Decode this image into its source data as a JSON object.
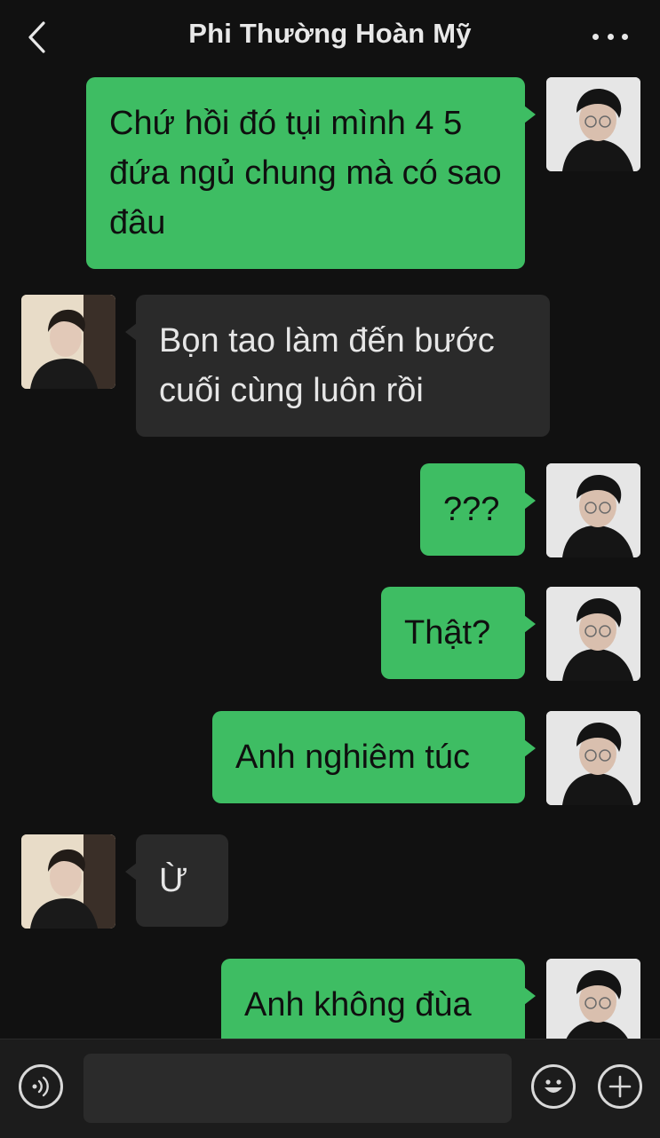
{
  "header": {
    "title": "Phi Thường Hoàn Mỹ",
    "back_icon": "chevron-left-icon",
    "more_icon": "more-dots-icon"
  },
  "messages": [
    {
      "sender": "self",
      "text": "Chứ hồi đó tụi mình 4 5 đứa ngủ chung mà có sao đâu"
    },
    {
      "sender": "other",
      "text": "Bọn tao làm đến bước cuối cùng luôn rồi"
    },
    {
      "sender": "self",
      "text": "???"
    },
    {
      "sender": "self",
      "text": "Thật?"
    },
    {
      "sender": "self",
      "text": "Anh nghiêm túc"
    },
    {
      "sender": "other",
      "text": "Ừ"
    },
    {
      "sender": "self",
      "text": "Anh không đùa"
    }
  ],
  "input": {
    "value": "",
    "voice_icon": "voice-icon",
    "emoji_icon": "emoji-icon",
    "add_icon": "plus-icon"
  },
  "colors": {
    "background": "#111111",
    "self_bubble": "#3ebd63",
    "other_bubble": "#2a2a2a",
    "bottom_bar": "#1c1c1c"
  }
}
